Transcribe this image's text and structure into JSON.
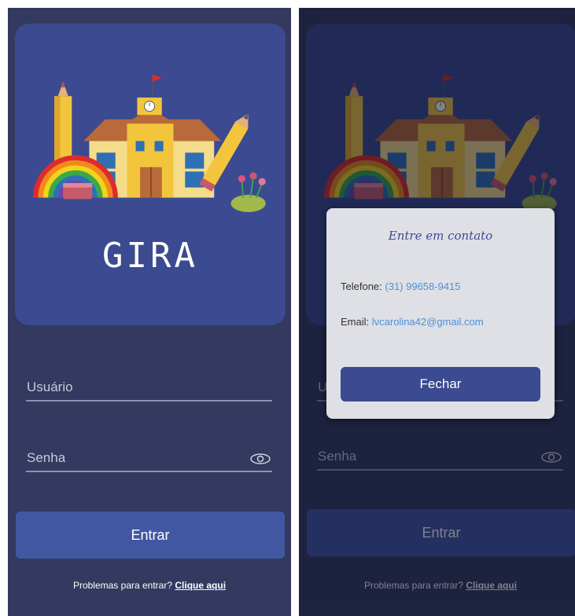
{
  "login": {
    "app_name": "GIRA",
    "username_placeholder": "Usuário",
    "password_placeholder": "Senha",
    "submit_label": "Entrar",
    "help_text": "Problemas para entrar?",
    "help_link": "Clique aqui"
  },
  "contact_modal": {
    "title": "Entre em contato",
    "phone_label": "Telefone:",
    "phone_value": "(31) 99658-9415",
    "email_label": "Email:",
    "email_value": "lvcarolina42@gmail.com",
    "close_label": "Fechar"
  },
  "icons": [
    "school-illustration",
    "pencil",
    "rainbow",
    "eraser",
    "flowers",
    "flag",
    "clock",
    "eye-icon"
  ],
  "colors": {
    "background": "#33395f",
    "card": "#3b4a91",
    "button": "#4157a2",
    "modal": "#dfe0e5",
    "link": "#4a90d9"
  }
}
